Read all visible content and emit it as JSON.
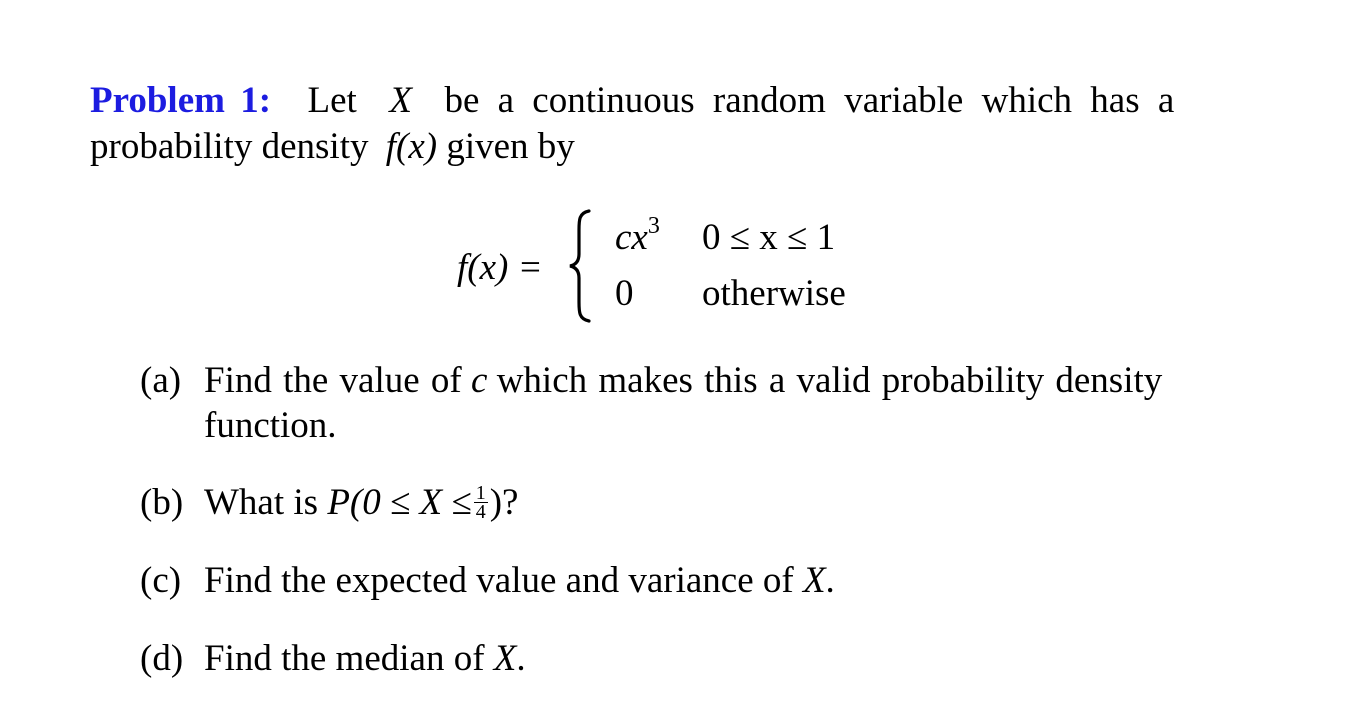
{
  "problem": {
    "heading": "Problem 1:",
    "intro_line1": "Let X be a continuous random variable which has a",
    "intro_parts": {
      "let": "Let",
      "var": "X",
      "rest": "be a continuous random variable which has a"
    },
    "intro_line2_text": "probability density",
    "intro_line2_func": "f(x)",
    "intro_line2_end": "given by",
    "accent_color": "#1c1ce0"
  },
  "equation": {
    "lhs": "f(x) =",
    "cases": [
      {
        "expr_base": "cx",
        "expr_sup": "3",
        "condition": "0 ≤ x ≤ 1"
      },
      {
        "expr_base": "0",
        "expr_sup": "",
        "condition": "otherwise"
      }
    ]
  },
  "questions": [
    {
      "label": "(a)",
      "line1": "Find the value of",
      "var": "c",
      "line1_end": "which makes this a valid probability density",
      "line2": "function."
    },
    {
      "label": "(b)",
      "text": "What is",
      "expr_prefix": "P(0 ≤ X ≤",
      "frac_num": "1",
      "frac_den": "4",
      "expr_suffix": ")?"
    },
    {
      "label": "(c)",
      "text": "Find the expected value and variance of",
      "var": "X",
      "end": "."
    },
    {
      "label": "(d)",
      "text": "Find the median of",
      "var": "X",
      "end": "."
    }
  ]
}
